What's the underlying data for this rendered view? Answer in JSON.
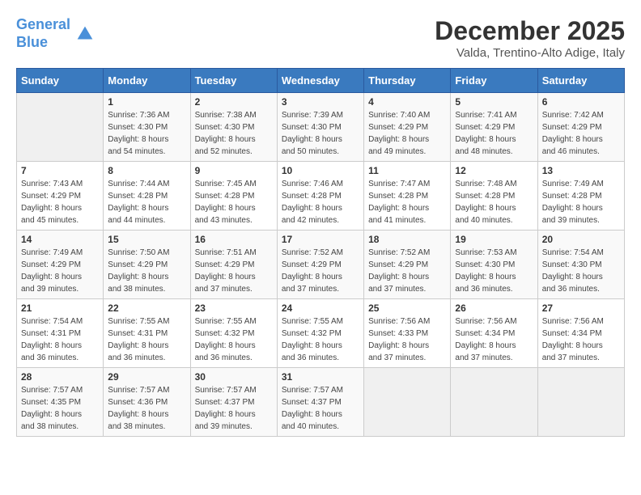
{
  "header": {
    "logo_line1": "General",
    "logo_line2": "Blue",
    "title": "December 2025",
    "subtitle": "Valda, Trentino-Alto Adige, Italy"
  },
  "days_of_week": [
    "Sunday",
    "Monday",
    "Tuesday",
    "Wednesday",
    "Thursday",
    "Friday",
    "Saturday"
  ],
  "weeks": [
    [
      {
        "day": "",
        "info": ""
      },
      {
        "day": "1",
        "info": "Sunrise: 7:36 AM\nSunset: 4:30 PM\nDaylight: 8 hours\nand 54 minutes."
      },
      {
        "day": "2",
        "info": "Sunrise: 7:38 AM\nSunset: 4:30 PM\nDaylight: 8 hours\nand 52 minutes."
      },
      {
        "day": "3",
        "info": "Sunrise: 7:39 AM\nSunset: 4:30 PM\nDaylight: 8 hours\nand 50 minutes."
      },
      {
        "day": "4",
        "info": "Sunrise: 7:40 AM\nSunset: 4:29 PM\nDaylight: 8 hours\nand 49 minutes."
      },
      {
        "day": "5",
        "info": "Sunrise: 7:41 AM\nSunset: 4:29 PM\nDaylight: 8 hours\nand 48 minutes."
      },
      {
        "day": "6",
        "info": "Sunrise: 7:42 AM\nSunset: 4:29 PM\nDaylight: 8 hours\nand 46 minutes."
      }
    ],
    [
      {
        "day": "7",
        "info": "Sunrise: 7:43 AM\nSunset: 4:29 PM\nDaylight: 8 hours\nand 45 minutes."
      },
      {
        "day": "8",
        "info": "Sunrise: 7:44 AM\nSunset: 4:28 PM\nDaylight: 8 hours\nand 44 minutes."
      },
      {
        "day": "9",
        "info": "Sunrise: 7:45 AM\nSunset: 4:28 PM\nDaylight: 8 hours\nand 43 minutes."
      },
      {
        "day": "10",
        "info": "Sunrise: 7:46 AM\nSunset: 4:28 PM\nDaylight: 8 hours\nand 42 minutes."
      },
      {
        "day": "11",
        "info": "Sunrise: 7:47 AM\nSunset: 4:28 PM\nDaylight: 8 hours\nand 41 minutes."
      },
      {
        "day": "12",
        "info": "Sunrise: 7:48 AM\nSunset: 4:28 PM\nDaylight: 8 hours\nand 40 minutes."
      },
      {
        "day": "13",
        "info": "Sunrise: 7:49 AM\nSunset: 4:28 PM\nDaylight: 8 hours\nand 39 minutes."
      }
    ],
    [
      {
        "day": "14",
        "info": "Sunrise: 7:49 AM\nSunset: 4:29 PM\nDaylight: 8 hours\nand 39 minutes."
      },
      {
        "day": "15",
        "info": "Sunrise: 7:50 AM\nSunset: 4:29 PM\nDaylight: 8 hours\nand 38 minutes."
      },
      {
        "day": "16",
        "info": "Sunrise: 7:51 AM\nSunset: 4:29 PM\nDaylight: 8 hours\nand 37 minutes."
      },
      {
        "day": "17",
        "info": "Sunrise: 7:52 AM\nSunset: 4:29 PM\nDaylight: 8 hours\nand 37 minutes."
      },
      {
        "day": "18",
        "info": "Sunrise: 7:52 AM\nSunset: 4:29 PM\nDaylight: 8 hours\nand 37 minutes."
      },
      {
        "day": "19",
        "info": "Sunrise: 7:53 AM\nSunset: 4:30 PM\nDaylight: 8 hours\nand 36 minutes."
      },
      {
        "day": "20",
        "info": "Sunrise: 7:54 AM\nSunset: 4:30 PM\nDaylight: 8 hours\nand 36 minutes."
      }
    ],
    [
      {
        "day": "21",
        "info": "Sunrise: 7:54 AM\nSunset: 4:31 PM\nDaylight: 8 hours\nand 36 minutes."
      },
      {
        "day": "22",
        "info": "Sunrise: 7:55 AM\nSunset: 4:31 PM\nDaylight: 8 hours\nand 36 minutes."
      },
      {
        "day": "23",
        "info": "Sunrise: 7:55 AM\nSunset: 4:32 PM\nDaylight: 8 hours\nand 36 minutes."
      },
      {
        "day": "24",
        "info": "Sunrise: 7:55 AM\nSunset: 4:32 PM\nDaylight: 8 hours\nand 36 minutes."
      },
      {
        "day": "25",
        "info": "Sunrise: 7:56 AM\nSunset: 4:33 PM\nDaylight: 8 hours\nand 37 minutes."
      },
      {
        "day": "26",
        "info": "Sunrise: 7:56 AM\nSunset: 4:34 PM\nDaylight: 8 hours\nand 37 minutes."
      },
      {
        "day": "27",
        "info": "Sunrise: 7:56 AM\nSunset: 4:34 PM\nDaylight: 8 hours\nand 37 minutes."
      }
    ],
    [
      {
        "day": "28",
        "info": "Sunrise: 7:57 AM\nSunset: 4:35 PM\nDaylight: 8 hours\nand 38 minutes."
      },
      {
        "day": "29",
        "info": "Sunrise: 7:57 AM\nSunset: 4:36 PM\nDaylight: 8 hours\nand 38 minutes."
      },
      {
        "day": "30",
        "info": "Sunrise: 7:57 AM\nSunset: 4:37 PM\nDaylight: 8 hours\nand 39 minutes."
      },
      {
        "day": "31",
        "info": "Sunrise: 7:57 AM\nSunset: 4:37 PM\nDaylight: 8 hours\nand 40 minutes."
      },
      {
        "day": "",
        "info": ""
      },
      {
        "day": "",
        "info": ""
      },
      {
        "day": "",
        "info": ""
      }
    ]
  ]
}
